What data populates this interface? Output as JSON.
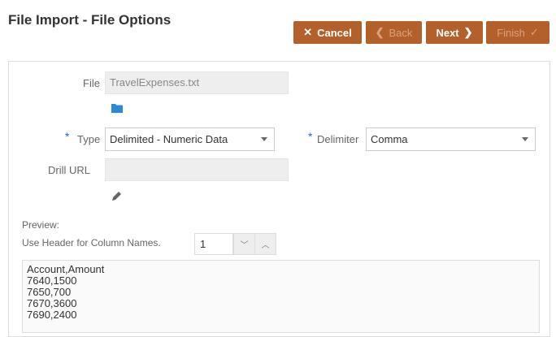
{
  "title": "File Import - File Options",
  "buttons": {
    "cancel": "Cancel",
    "back": "Back",
    "next": "Next",
    "finish": "Finish"
  },
  "form": {
    "file_label": "File",
    "file_value": "TravelExpenses.txt",
    "type_label": "Type",
    "type_value": "Delimited - Numeric Data",
    "delimiter_label": "Delimiter",
    "delimiter_value": "Comma",
    "drill_label": "Drill URL",
    "drill_value": "",
    "required_marker": "*"
  },
  "preview": {
    "label": "Preview:",
    "header_label": "Use Header for Column Names.",
    "header_value": "1",
    "lines": [
      "Account,Amount",
      "7640,1500",
      "7650,700",
      "7670,3600",
      "7690,2400"
    ]
  },
  "colors": {
    "accent": "#b4602a",
    "required": "#2a6fb6"
  }
}
